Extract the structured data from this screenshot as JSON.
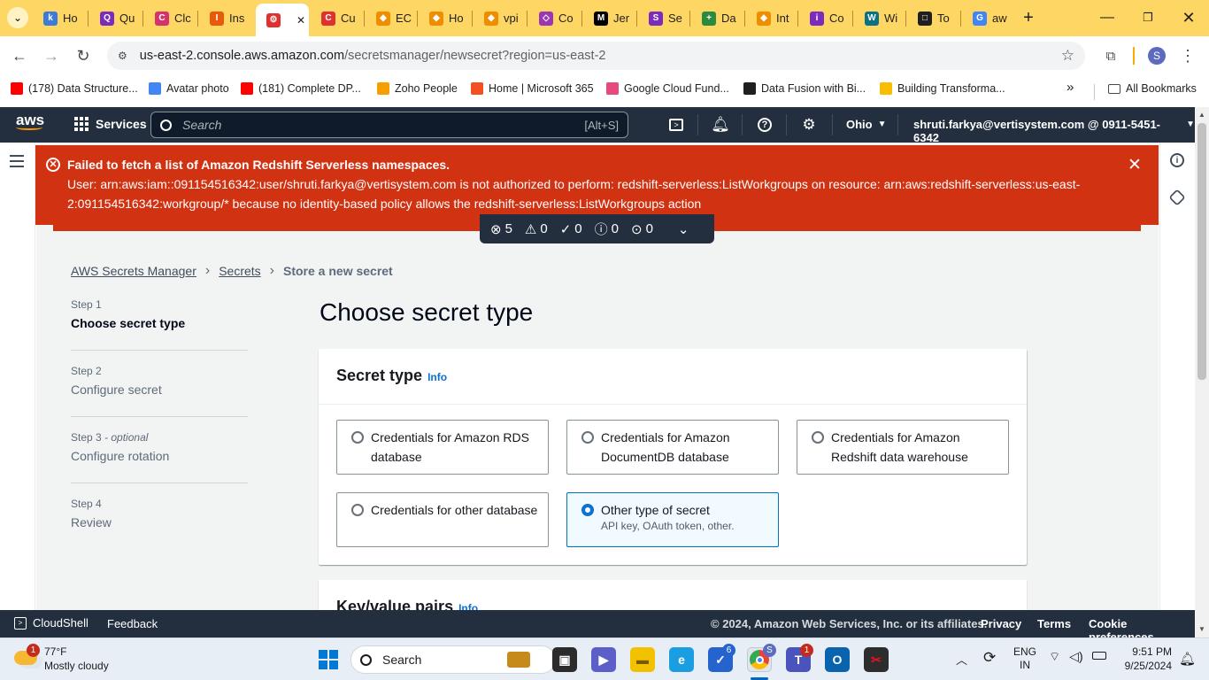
{
  "browser": {
    "tabs": [
      {
        "label": "Ho",
        "color": "#3d7bd9",
        "glyph": "k"
      },
      {
        "label": "Qu",
        "color": "#7b2cbf",
        "glyph": "Q"
      },
      {
        "label": "Clc",
        "color": "#d6336c",
        "glyph": "C"
      },
      {
        "label": "Ins",
        "color": "#e8590c",
        "glyph": "I"
      },
      {
        "label": "",
        "color": "#e03131",
        "glyph": "⚙",
        "active": true
      },
      {
        "label": "Cu",
        "color": "#e03131",
        "glyph": "C"
      },
      {
        "label": "EC",
        "color": "#f08c00",
        "glyph": "◆"
      },
      {
        "label": "Ho",
        "color": "#f08c00",
        "glyph": "◆"
      },
      {
        "label": "vpi",
        "color": "#f08c00",
        "glyph": "◆"
      },
      {
        "label": "Co",
        "color": "#9c36b5",
        "glyph": "◇"
      },
      {
        "label": "Jer",
        "color": "#000000",
        "glyph": "M"
      },
      {
        "label": "Se",
        "color": "#7b2cbf",
        "glyph": "S"
      },
      {
        "label": "Da",
        "color": "#2b8a3e",
        "glyph": "+"
      },
      {
        "label": "Int",
        "color": "#f08c00",
        "glyph": "◆"
      },
      {
        "label": "Co",
        "color": "#7b2cbf",
        "glyph": "i"
      },
      {
        "label": "Wi",
        "color": "#0b7285",
        "glyph": "W"
      },
      {
        "label": "To",
        "color": "#1f1f1f",
        "glyph": "□"
      },
      {
        "label": "aw",
        "color": "#4285f4",
        "glyph": "G"
      }
    ],
    "new_tab_icon": "plus-icon",
    "url_host": "us-east-2.console.aws.amazon.com",
    "url_path": "/secretsmanager/newsecret?region=us-east-2",
    "profile_initial": "S",
    "bookmarks": [
      {
        "label": "(178) Data Structure...",
        "color": "#ff0000"
      },
      {
        "label": "Avatar photo",
        "color": "#4285f4"
      },
      {
        "label": "(181) Complete DP...",
        "color": "#ff0000"
      },
      {
        "label": "Zoho People",
        "color": "#f59f00"
      },
      {
        "label": "Home | Microsoft 365",
        "color": "#f25022"
      },
      {
        "label": "Google Cloud Fund...",
        "color": "#e64980"
      },
      {
        "label": "Data Fusion with Bi...",
        "color": "#1f1f1f"
      },
      {
        "label": "Building Transforma...",
        "color": "#fbbc04"
      }
    ],
    "more_bookmarks": "»",
    "all_bookmarks": "All Bookmarks"
  },
  "aws_header": {
    "logo": "aws",
    "services": "Services",
    "search_placeholder": "Search",
    "search_shortcut": "[Alt+S]",
    "region": "Ohio",
    "account": "shruti.farkya@vertisystem.com @ 0911-5451-6342"
  },
  "flash": {
    "title": "Failed to fetch a list of Amazon Redshift Serverless namespaces.",
    "message": "User: arn:aws:iam::091154516342:user/shruti.farkya@vertisystem.com is not authorized to perform: redshift-serverless:ListWorkgroups on resource: arn:aws:redshift-serverless:us-east-2:091154516342:workgroup/* because no identity-based policy allows the redshift-serverless:ListWorkgroups action",
    "counts": {
      "error": "5",
      "warning": "0",
      "success": "0",
      "info": "0",
      "progress": "0"
    }
  },
  "breadcrumb": {
    "root": "AWS Secrets Manager",
    "secrets": "Secrets",
    "current": "Store a new secret"
  },
  "steps": [
    {
      "step": "Step 1",
      "optional": "",
      "name": "Choose secret type"
    },
    {
      "step": "Step 2",
      "optional": "",
      "name": "Configure secret"
    },
    {
      "step": "Step 3",
      "optional": " - optional",
      "name": "Configure rotation"
    },
    {
      "step": "Step 4",
      "optional": "",
      "name": "Review"
    }
  ],
  "main": {
    "title": "Choose secret type",
    "secret_type_heading": "Secret type",
    "info": "Info",
    "options": [
      {
        "label": "Credentials for Amazon RDS database",
        "desc": "",
        "selected": false
      },
      {
        "label": "Credentials for Amazon DocumentDB database",
        "desc": "",
        "selected": false
      },
      {
        "label": "Credentials for Amazon Redshift data warehouse",
        "desc": "",
        "selected": false
      },
      {
        "label": "Credentials for other database",
        "desc": "",
        "selected": false
      },
      {
        "label": "Other type of secret",
        "desc": "API key, OAuth token, other.",
        "selected": true
      }
    ],
    "kv_heading": "Key/value pairs",
    "kv_info": "Info"
  },
  "footer": {
    "cloudshell": "CloudShell",
    "feedback": "Feedback",
    "copyright": "© 2024, Amazon Web Services, Inc. or its affiliates.",
    "privacy": "Privacy",
    "terms": "Terms",
    "cookies": "Cookie preferences"
  },
  "taskbar": {
    "weather_temp": "77°F",
    "weather_desc": "Mostly cloudy",
    "weather_badge": "1",
    "search": "Search",
    "todo_badge": "6",
    "chrome_badge": "S",
    "teams_badge": "1",
    "lang_top": "ENG",
    "lang_bottom": "IN",
    "time": "9:51 PM",
    "date": "9/25/2024"
  }
}
